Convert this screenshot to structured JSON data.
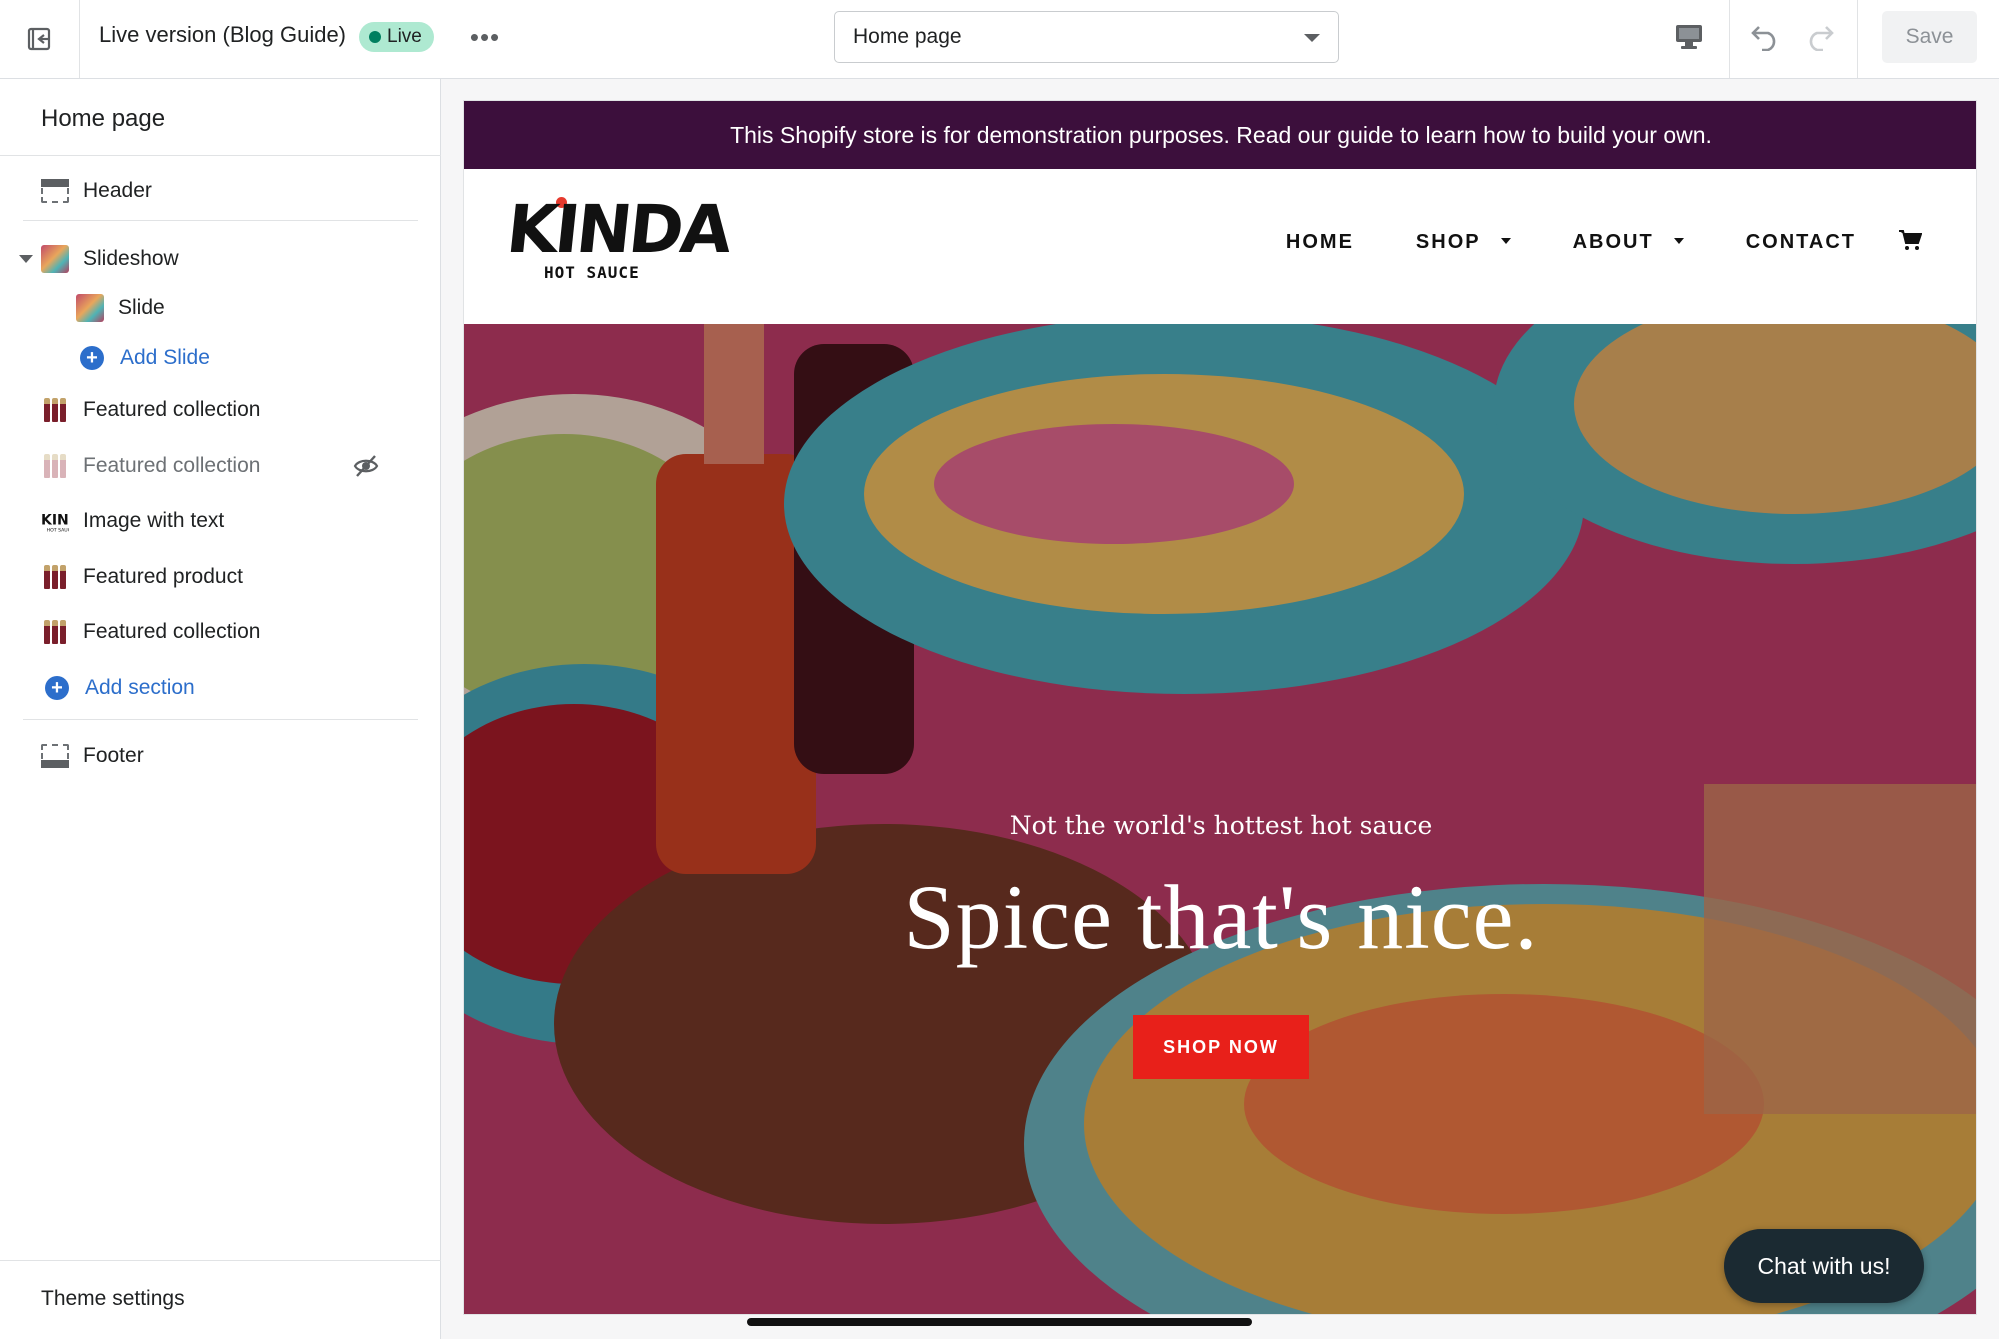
{
  "topbar": {
    "version_title": "Live version (Blog Guide)",
    "live_badge": "Live",
    "more_label": "•••",
    "page_select": "Home page",
    "save_label": "Save"
  },
  "sidebar": {
    "title": "Home page",
    "items": [
      {
        "label": "Header"
      },
      {
        "label": "Slideshow"
      },
      {
        "label": "Slide"
      },
      {
        "label": "Add Slide"
      },
      {
        "label": "Featured collection"
      },
      {
        "label": "Featured collection"
      },
      {
        "label": "Image with text"
      },
      {
        "label": "Featured product"
      },
      {
        "label": "Featured collection"
      },
      {
        "label": "Add section"
      },
      {
        "label": "Footer"
      }
    ],
    "theme_settings": "Theme settings"
  },
  "store": {
    "announcement": "This Shopify store is for demonstration purposes. Read our guide to learn how to build your own.",
    "logo_main": "KINDA",
    "logo_sub": "HOT SAUCE",
    "nav": [
      "HOME",
      "SHOP",
      "ABOUT",
      "CONTACT"
    ],
    "hero_subtitle": "Not the world's hottest hot sauce",
    "hero_title": "Spice that's nice.",
    "cta": "SHOP NOW",
    "chat": "Chat with us!"
  },
  "colors": {
    "announcement_bg": "#3c0f3c",
    "cta_bg": "#e8201a",
    "live_badge_bg": "#aee9d1",
    "link_blue": "#2c6ecb",
    "chat_bg": "#1b2a32"
  }
}
